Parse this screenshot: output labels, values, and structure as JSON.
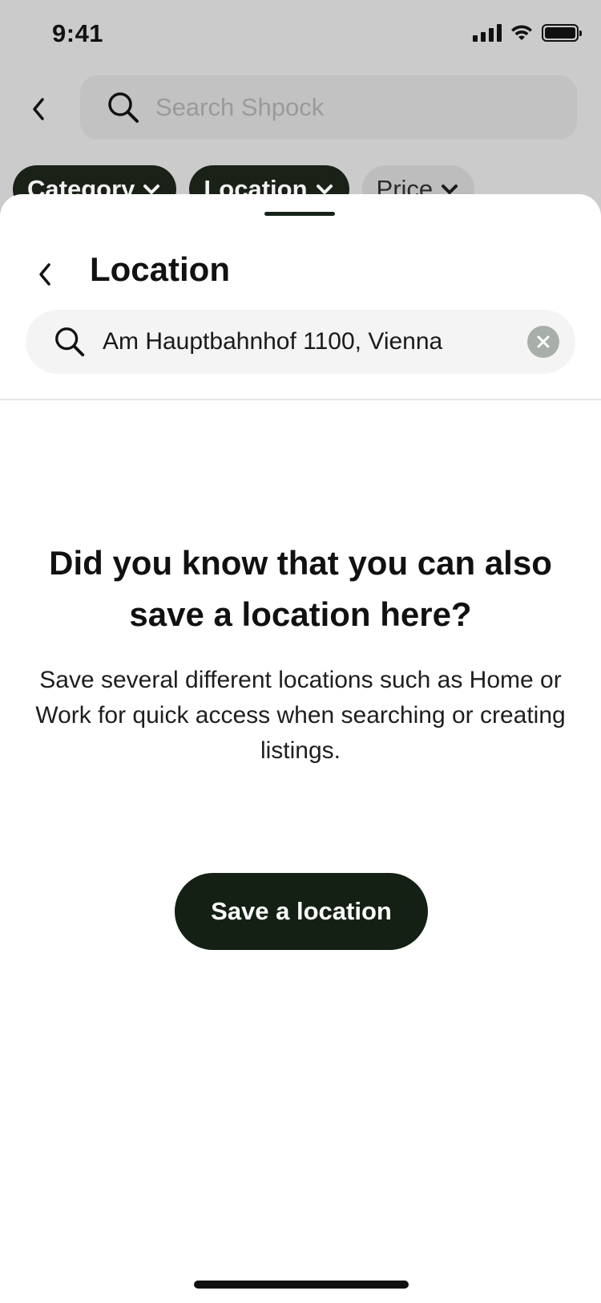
{
  "status_bar": {
    "time": "9:41"
  },
  "background": {
    "search_placeholder": "Search Shpock",
    "filter_chips": [
      {
        "label": "Category",
        "active": true
      },
      {
        "label": "Location",
        "active": true
      },
      {
        "label": "Price",
        "active": false
      }
    ]
  },
  "sheet": {
    "title": "Location",
    "search": {
      "value": "Am Hauptbahnhof 1100, Vienna"
    },
    "info": {
      "headline": "Did you know that you can also save a location here?",
      "body": "Save several different locations such as Home or Work for quick access when searching or creating listings."
    },
    "cta_label": "Save a location"
  },
  "icons": {
    "back": "chevron-left-icon",
    "search": "search-icon",
    "clear": "clear-icon",
    "chip_chevron": "chevron-down-icon"
  },
  "colors": {
    "brand_dark": "#142014",
    "overlay": "#cbcbcb",
    "sheet": "#ffffff"
  }
}
